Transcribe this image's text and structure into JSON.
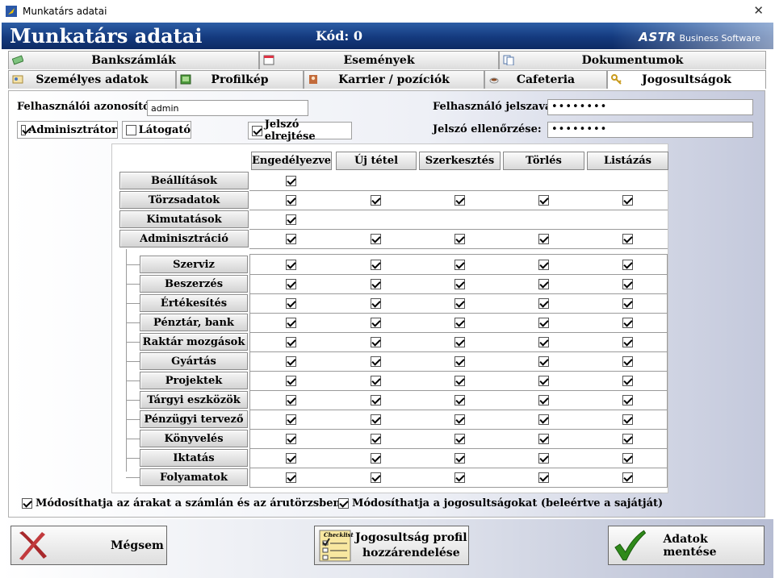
{
  "window": {
    "title": "Munkatárs adatai"
  },
  "header": {
    "title": "Munkatárs adatai",
    "code": "Kód: 0",
    "brand_bold": "ASTR",
    "brand_text": "Business Software"
  },
  "tabs": {
    "row1": [
      {
        "label": "Bankszámlák"
      },
      {
        "label": "Események"
      },
      {
        "label": "Dokumentumok"
      }
    ],
    "row2": [
      {
        "label": "Személyes adatok"
      },
      {
        "label": "Profilkép"
      },
      {
        "label": "Karrier / pozíciók"
      },
      {
        "label": "Cafeteria"
      },
      {
        "label": "Jogosultságok",
        "active": true
      }
    ]
  },
  "form": {
    "user_id_label": "Felhasználói azonosító:",
    "user_id_value": "admin",
    "password_label": "Felhasználó jelszava:",
    "password_value": "••••••••",
    "password_confirm_label": "Jelszó ellenőrzése:",
    "password_confirm_value": "••••••••",
    "admin_label": "Adminisztrátor",
    "admin_checked": true,
    "visitor_label": "Látogató",
    "visitor_checked": false,
    "hide_pwd_label": "Jelszó elrejtése",
    "hide_pwd_checked": true
  },
  "permissions": {
    "columns": [
      "Engedélyezve",
      "Új tétel",
      "Szerkesztés",
      "Törlés",
      "Listázás"
    ],
    "top_rows": [
      {
        "label": "Beállítások",
        "checks": [
          true,
          null,
          null,
          null,
          null
        ]
      },
      {
        "label": "Törzsadatok",
        "checks": [
          true,
          true,
          true,
          true,
          true
        ]
      },
      {
        "label": "Kimutatások",
        "checks": [
          true,
          null,
          null,
          null,
          null
        ]
      },
      {
        "label": "Adminisztráció",
        "checks": [
          true,
          true,
          true,
          true,
          true
        ]
      }
    ],
    "sub_rows": [
      {
        "label": "Szerviz",
        "checks": [
          true,
          true,
          true,
          true,
          true
        ]
      },
      {
        "label": "Beszerzés",
        "checks": [
          true,
          true,
          true,
          true,
          true
        ]
      },
      {
        "label": "Értékesítés",
        "checks": [
          true,
          true,
          true,
          true,
          true
        ]
      },
      {
        "label": "Pénztár, bank",
        "checks": [
          true,
          true,
          true,
          true,
          true
        ]
      },
      {
        "label": "Raktár mozgások",
        "checks": [
          true,
          true,
          true,
          true,
          true
        ]
      },
      {
        "label": "Gyártás",
        "checks": [
          true,
          true,
          true,
          true,
          true
        ]
      },
      {
        "label": "Projektek",
        "checks": [
          true,
          true,
          true,
          true,
          true
        ]
      },
      {
        "label": "Tárgyi eszközök",
        "checks": [
          true,
          true,
          true,
          true,
          true
        ]
      },
      {
        "label": "Pénzügyi tervező",
        "checks": [
          true,
          true,
          true,
          true,
          true
        ]
      },
      {
        "label": "Könyvelés",
        "checks": [
          true,
          true,
          true,
          true,
          true
        ]
      },
      {
        "label": "Iktatás",
        "checks": [
          true,
          true,
          true,
          true,
          true
        ]
      },
      {
        "label": "Folyamatok",
        "checks": [
          true,
          true,
          true,
          true,
          true
        ]
      }
    ]
  },
  "options": {
    "modify_prices_label": "Módosíthatja az árakat a számlán és az árutörzsben",
    "modify_prices_checked": true,
    "modify_perms_label": "Módosíthatja a jogosultságokat (beleértve a sajátját)",
    "modify_perms_checked": true
  },
  "footer": {
    "cancel_label": "Mégsem",
    "assign_profile_line1": "Jogosultság profil",
    "assign_profile_line2": "hozzárendelése",
    "checklist_text": "Checklist",
    "save_label": "Adatok mentése"
  },
  "colors": {
    "header_dark": "#0d2a63",
    "header_light": "#2d5ea6",
    "cancel_icon": "#a8292c",
    "save_icon": "#2f8a1a"
  }
}
